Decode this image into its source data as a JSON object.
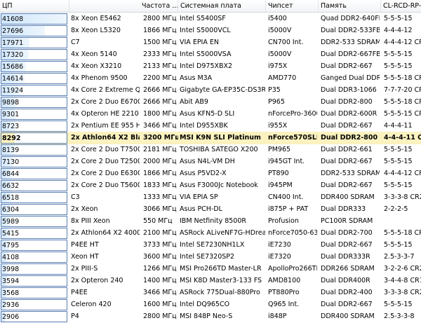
{
  "columns": [
    "ЦП",
    "Частота ...",
    "Системная плата",
    "Чипсет",
    "Память",
    "CL-RCD-RP-R..."
  ],
  "bar_max": 41608,
  "highlight_index": 10,
  "rows": [
    {
      "score": "41608",
      "cpu": "8x Xeon E5462",
      "clock": "2800 МГц",
      "board": "Intel S5400SF",
      "chipset": "i5400",
      "memory": "Quad DDR2-640FB",
      "timing": "5-5-5-15"
    },
    {
      "score": "27696",
      "cpu": "8x Xeon L5320",
      "clock": "1866 МГц",
      "board": "Intel S5000VCL",
      "chipset": "i5000V",
      "memory": "Dual DDR2-533FB",
      "timing": "4-4-4-12"
    },
    {
      "score": "17971",
      "cpu": "C7",
      "clock": "1500 МГц",
      "board": "VIA EPIA EN",
      "chipset": "CN700 Int.",
      "memory": "DDR2-533 SDRAM",
      "timing": "4-4-4-12 CR2"
    },
    {
      "score": "17320",
      "cpu": "4x Xeon 5140",
      "clock": "2333 МГц",
      "board": "Intel S5000VSA",
      "chipset": "i5000V",
      "memory": "Dual DDR2-667FB",
      "timing": "5-5-5-15"
    },
    {
      "score": "15686",
      "cpu": "4x Xeon X3210",
      "clock": "2133 МГц",
      "board": "Intel D975XBX2",
      "chipset": "i975X",
      "memory": "Dual DDR2-667",
      "timing": "5-5-5-15"
    },
    {
      "score": "14614",
      "cpu": "4x Phenom 9500",
      "clock": "2200 МГц",
      "board": "Asus M3A",
      "chipset": "AMD770",
      "memory": "Ganged Dual DDR...",
      "timing": "5-5-5-18 CR2"
    },
    {
      "score": "11924",
      "cpu": "4x Core 2 Extreme QX...",
      "clock": "2666 МГц",
      "board": "Gigabyte GA-EP35C-DS3R",
      "chipset": "P35",
      "memory": "Dual DDR3-1066",
      "timing": "7-7-7-20 CR2"
    },
    {
      "score": "9898",
      "cpu": "2x Core 2 Duo E6700",
      "clock": "2666 МГц",
      "board": "Abit AB9",
      "chipset": "P965",
      "memory": "Dual DDR2-800",
      "timing": "5-5-5-18 CR2"
    },
    {
      "score": "9301",
      "cpu": "4x Opteron HE 2210",
      "clock": "1800 МГц",
      "board": "Asus KFN5-D SLI",
      "chipset": "nForcePro-3600",
      "memory": "Dual DDR2-600R",
      "timing": "5-5-5-15 CR2"
    },
    {
      "score": "8723",
      "cpu": "2x Pentium EE 955 HT",
      "clock": "3466 МГц",
      "board": "Intel D955XBK",
      "chipset": "i955X",
      "memory": "Dual DDR2-667",
      "timing": "4-4-4-11"
    },
    {
      "score": "8292",
      "cpu": "2x Athlon64 X2 Black ...",
      "clock": "3200 МГц",
      "board": "MSI K9N SLI Platinum",
      "chipset": "nForce570SLI",
      "memory": "Dual DDR2-800",
      "timing": "4-4-4-11 CR1"
    },
    {
      "score": "8139",
      "cpu": "2x Core 2 Duo T7500",
      "clock": "2181 МГц",
      "board": "TOSHIBA SATEGO X200",
      "chipset": "PM965",
      "memory": "Dual DDR2-661",
      "timing": "5-5-5-15"
    },
    {
      "score": "7130",
      "cpu": "2x Core 2 Duo T2500",
      "clock": "2000 МГц",
      "board": "Asus N4L-VM DH",
      "chipset": "i945GT Int.",
      "memory": "Dual DDR2-667",
      "timing": "5-5-5-15"
    },
    {
      "score": "6844",
      "cpu": "2x Core 2 Duo E6300",
      "clock": "1866 МГц",
      "board": "Asus P5VD2-X",
      "chipset": "PT890",
      "memory": "DDR2-533 SDRAM",
      "timing": "4-4-4-12 CR2"
    },
    {
      "score": "6632",
      "cpu": "2x Core 2 Duo T5600",
      "clock": "1833 МГц",
      "board": "Asus F3000Jc Notebook",
      "chipset": "i945PM",
      "memory": "Dual DDR2-667",
      "timing": "5-5-5-15"
    },
    {
      "score": "6518",
      "cpu": "C3",
      "clock": "1333 МГц",
      "board": "VIA EPIA SP",
      "chipset": "CN400 Int.",
      "memory": "DDR400 SDRAM",
      "timing": "3-3-3-8 CR2"
    },
    {
      "score": "6304",
      "cpu": "2x Xeon",
      "clock": "3066 МГц",
      "board": "Asus PCH-DL",
      "chipset": "i875P + PAT",
      "memory": "Dual DDR333",
      "timing": "2-2-2-5"
    },
    {
      "score": "5989",
      "cpu": "8x PIII Xeon",
      "clock": "550 МГц",
      "board": "IBM Netfinity 8500R",
      "chipset": "Profusion",
      "memory": "PC100R SDRAM",
      "timing": ""
    },
    {
      "score": "5415",
      "cpu": "2x Athlon64 X2 4000+",
      "clock": "2100 МГц",
      "board": "ASRock ALiveNF7G-HDrea...",
      "chipset": "nForce7050-63...",
      "memory": "Dual DDR2-700",
      "timing": "5-5-5-18 CR2"
    },
    {
      "score": "4795",
      "cpu": "P4EE HT",
      "clock": "3733 МГц",
      "board": "Intel SE7230NH1LX",
      "chipset": "iE7230",
      "memory": "Dual DDR2-667",
      "timing": "5-5-5-15"
    },
    {
      "score": "4108",
      "cpu": "Xeon HT",
      "clock": "3600 МГц",
      "board": "Intel SE7320SP2",
      "chipset": "iE7320",
      "memory": "Dual DDR333R",
      "timing": "2.5-3-3-7"
    },
    {
      "score": "3998",
      "cpu": "2x PIII-S",
      "clock": "1266 МГц",
      "board": "MSI Pro266TD Master-LR",
      "chipset": "ApolloPro266TD",
      "memory": "DDR266 SDRAM",
      "timing": "3-2-2-6 CR2"
    },
    {
      "score": "3594",
      "cpu": "2x Opteron 240",
      "clock": "1400 МГц",
      "board": "MSI K8D Master3-133 FS",
      "chipset": "AMD8100",
      "memory": "Dual DDR400R",
      "timing": "3-4-4-8 CR1"
    },
    {
      "score": "3568",
      "cpu": "P4EE",
      "clock": "3466 МГц",
      "board": "ASRock 775Dual-880Pro",
      "chipset": "PT880Pro",
      "memory": "Dual DDR2-400",
      "timing": "3-3-3-8 CR2"
    },
    {
      "score": "2936",
      "cpu": "Celeron 420",
      "clock": "1600 МГц",
      "board": "Intel DQ965CO",
      "chipset": "Q965 Int.",
      "memory": "Dual DDR2-667",
      "timing": "5-5-5-15"
    },
    {
      "score": "2906",
      "cpu": "P4",
      "clock": "2800 МГц",
      "board": "MSI 848P Neo-S",
      "chipset": "i848P",
      "memory": "DDR400 SDRAM",
      "timing": "2.5-3-3-8"
    }
  ]
}
